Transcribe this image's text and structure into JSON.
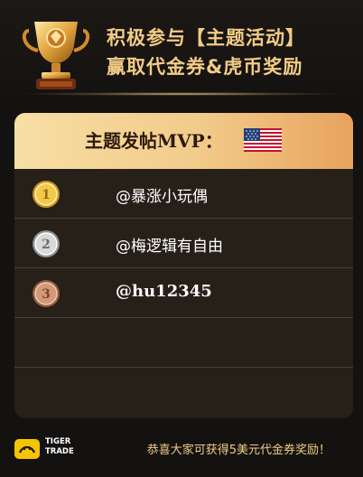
{
  "header": {
    "line1": "积极参与【主题活动】",
    "line2": "赢取代金券&虎币奖励"
  },
  "card": {
    "title": "主题发帖MVP：",
    "flag_icon": "us-flag-icon",
    "rows": [
      {
        "medal": "1",
        "name": "@暴涨小玩偶"
      },
      {
        "medal": "2",
        "name": "@梅逻辑有自由"
      },
      {
        "medal": "3",
        "name": "@hu12345"
      },
      {
        "medal": "",
        "name": ""
      },
      {
        "medal": "",
        "name": ""
      }
    ]
  },
  "footer": {
    "brand_line1": "TIGER",
    "brand_line2": "TRADE",
    "note": "恭喜大家可获得5美元代金券奖励！"
  },
  "colors": {
    "gold_text": "#f2cc86",
    "card_bg": "#262019",
    "header_gradient_start": "#f7dfa4",
    "header_gradient_end": "#e8a35f"
  }
}
